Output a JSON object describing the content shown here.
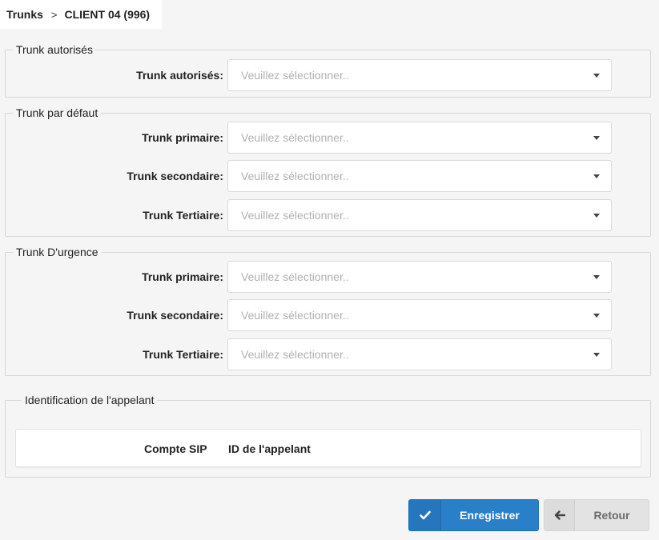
{
  "breadcrumb": {
    "parent": "Trunks",
    "separator": ">",
    "current": "CLIENT 04 (996)"
  },
  "placeholder": "Veuillez sélectionner..",
  "sections": {
    "authorized": {
      "legend": "Trunk autorisés",
      "fields": [
        {
          "label": "Trunk autorisés:",
          "value": ""
        }
      ]
    },
    "default": {
      "legend": "Trunk par défaut",
      "fields": [
        {
          "label": "Trunk primaire:",
          "value": ""
        },
        {
          "label": "Trunk secondaire:",
          "value": ""
        },
        {
          "label": "Trunk Tertiaire:",
          "value": ""
        }
      ]
    },
    "emergency": {
      "legend": "Trunk D'urgence",
      "fields": [
        {
          "label": "Trunk primaire:",
          "value": ""
        },
        {
          "label": "Trunk secondaire:",
          "value": ""
        },
        {
          "label": "Trunk Tertiaire:",
          "value": ""
        }
      ]
    },
    "caller_id": {
      "legend": "Identification de l'appelant",
      "columns": [
        "Compte SIP",
        "ID de l'appelant"
      ]
    }
  },
  "buttons": {
    "save": {
      "label": "Enregistrer",
      "icon": "check-icon"
    },
    "back": {
      "label": "Retour",
      "icon": "arrow-left-icon"
    }
  },
  "colors": {
    "primary": "#2a7fc9",
    "background": "#f5f5f5"
  }
}
